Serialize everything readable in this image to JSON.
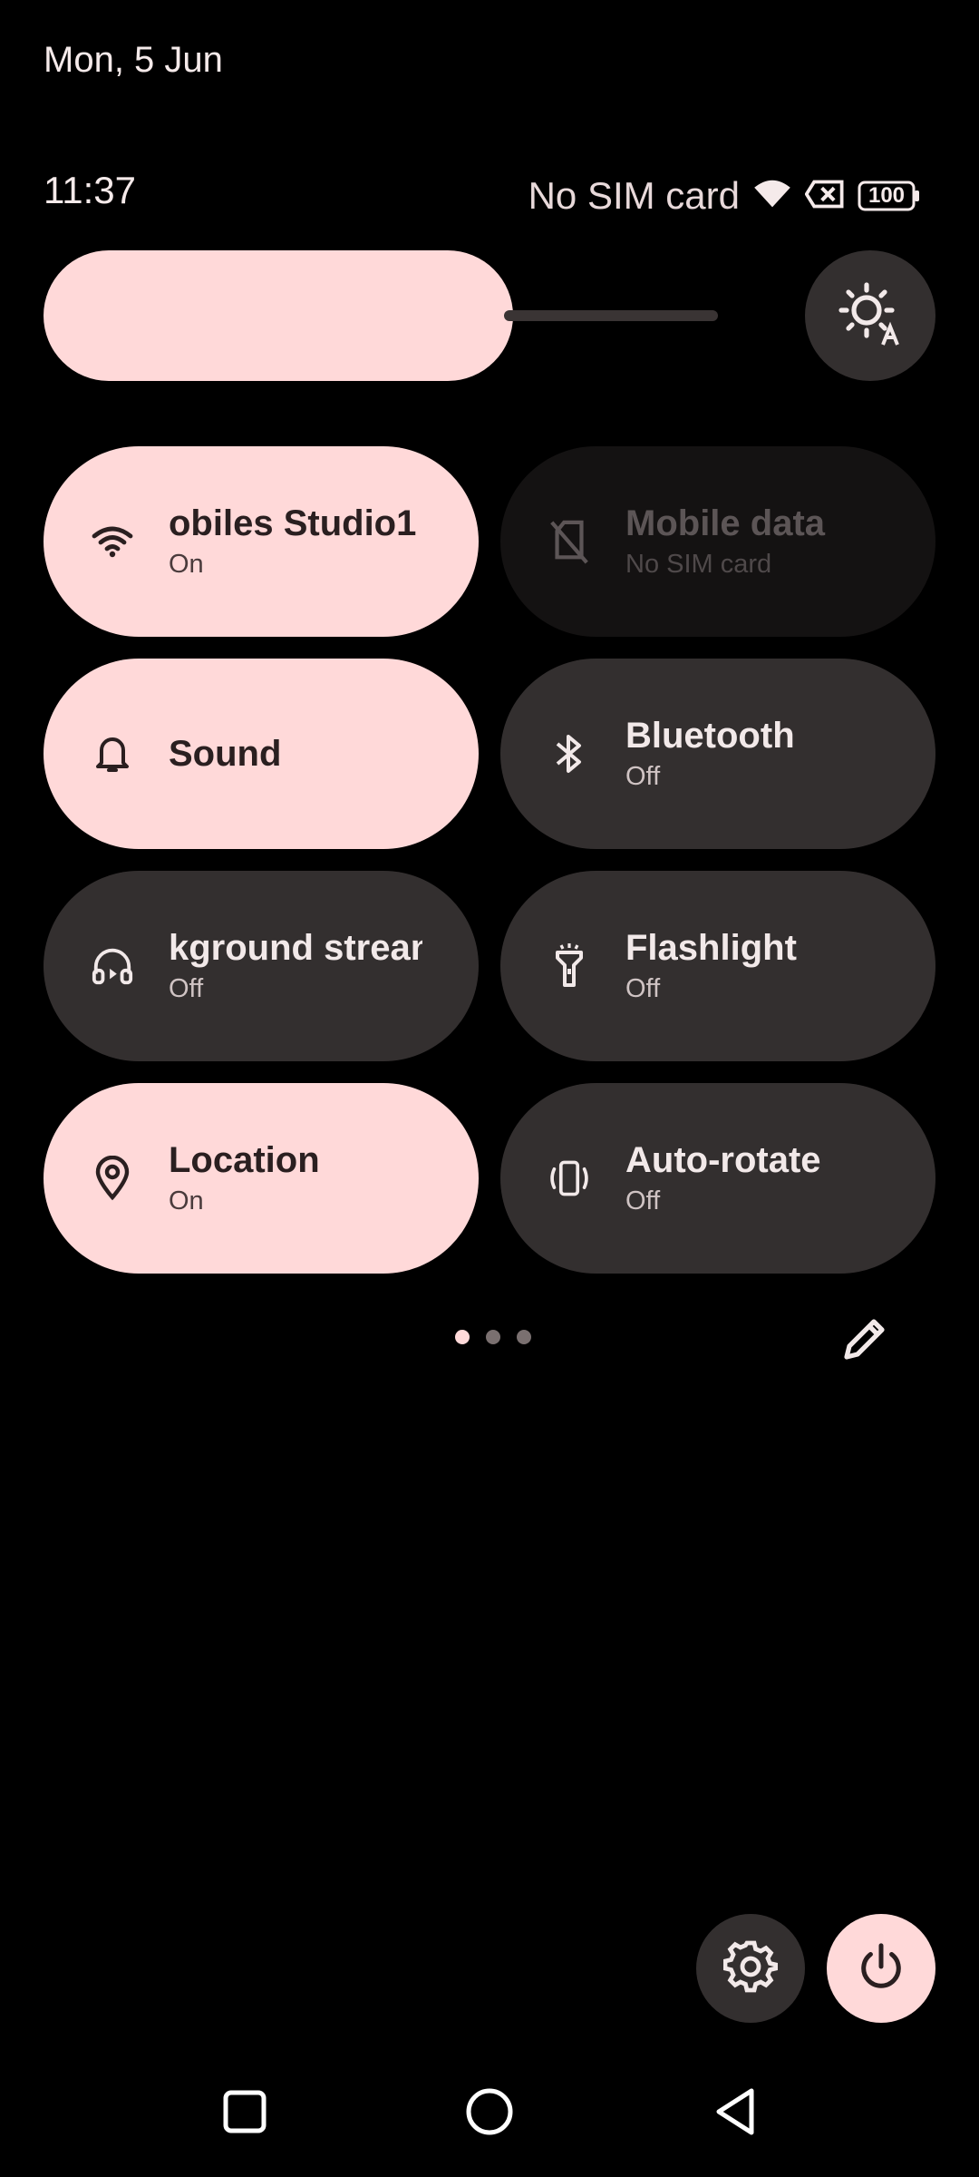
{
  "header": {
    "date": "Mon, 5 Jun",
    "time": "11:37",
    "sim_status": "No SIM card",
    "battery": "100"
  },
  "brightness": {
    "level_fraction": 0.6
  },
  "tiles": [
    {
      "title": "obiles Studio1",
      "subtitle": "On",
      "state": "active",
      "icon": "wifi-icon"
    },
    {
      "title": "Mobile data",
      "subtitle": "No SIM card",
      "state": "disabled",
      "icon": "no-sim-icon"
    },
    {
      "title": "Sound",
      "subtitle": "",
      "state": "active",
      "icon": "bell-icon"
    },
    {
      "title": "Bluetooth",
      "subtitle": "Off",
      "state": "inactive",
      "icon": "bluetooth-icon"
    },
    {
      "title": "kground strean",
      "subtitle": "Off",
      "state": "inactive",
      "icon": "headphones-icon"
    },
    {
      "title": "Flashlight",
      "subtitle": "Off",
      "state": "inactive",
      "icon": "flashlight-icon"
    },
    {
      "title": "Location",
      "subtitle": "On",
      "state": "active",
      "icon": "location-pin-icon"
    },
    {
      "title": "Auto-rotate",
      "subtitle": "Off",
      "state": "inactive",
      "icon": "auto-rotate-icon"
    }
  ],
  "pager": {
    "pages": 3,
    "current": 1
  },
  "colors": {
    "accent": "#ffd9d9",
    "tile_inactive": "#332f2f",
    "background": "#000000"
  }
}
